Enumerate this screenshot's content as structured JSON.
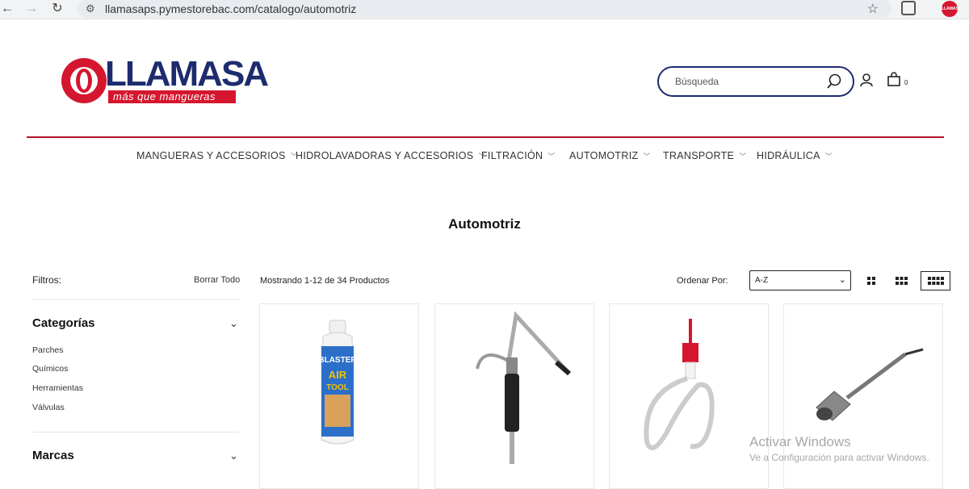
{
  "browser": {
    "url": "llamasaps.pymestorebac.com/catalogo/automotriz",
    "profile_badge": "LLAMASA"
  },
  "header": {
    "logo_text": "LLAMASA",
    "logo_tagline": "más que mangueras",
    "search_placeholder": "Búsqueda",
    "cart_count": "0"
  },
  "nav": {
    "items": [
      {
        "label": "MANGUERAS Y ACCESORIOS"
      },
      {
        "label": "HIDROLAVADORAS Y ACCESORIOS"
      },
      {
        "label": "FILTRACIÓN"
      },
      {
        "label": "AUTOMOTRIZ"
      },
      {
        "label": "TRANSPORTE"
      },
      {
        "label": "HIDRÁULICA"
      }
    ]
  },
  "page": {
    "title": "Automotriz"
  },
  "sidebar": {
    "filters_label": "Filtros:",
    "clear_all": "Borrar Todo",
    "categories_heading": "Categorías",
    "categories": [
      "Parches",
      "Químicos",
      "Herramientas",
      "Válvulas"
    ],
    "brands_heading": "Marcas"
  },
  "toolbar": {
    "showing_text": "Mostrando 1-12 de 34 Productos",
    "sort_label": "Ordenar Por:",
    "sort_value": "A-Z"
  },
  "product_label": "BLASTER",
  "watermark": {
    "line1": "Activar Windows",
    "line2": "Ve a Configuración para activar Windows."
  },
  "colors": {
    "brand_blue": "#1d2b6e",
    "brand_red": "#d5162f"
  }
}
